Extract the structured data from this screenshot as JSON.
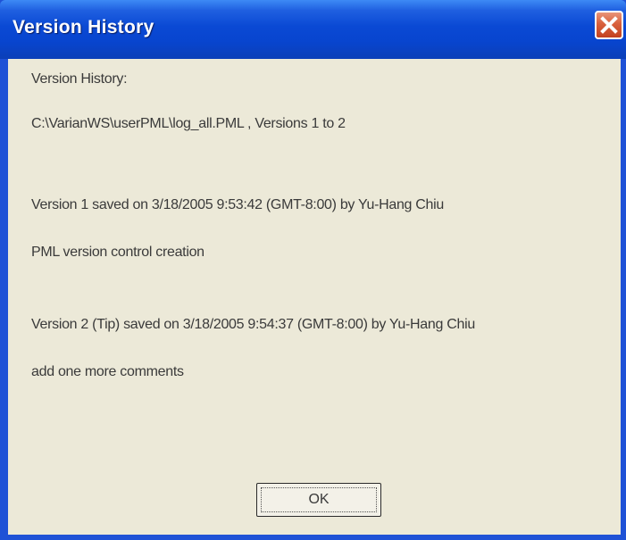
{
  "window": {
    "title": "Version History"
  },
  "content": {
    "heading": "Version History:",
    "file_line": "C:\\VarianWS\\userPML\\log_all.PML , Versions 1 to 2",
    "entries": [
      {
        "header": "Version 1 saved on 3/18/2005 9:53:42 (GMT-8:00) by Yu-Hang Chiu",
        "comment": "PML version control creation"
      },
      {
        "header": "Version 2 (Tip) saved on 3/18/2005 9:54:37 (GMT-8:00) by Yu-Hang Chiu",
        "comment": "add one more comments"
      }
    ]
  },
  "buttons": {
    "ok_label": "OK"
  },
  "colors": {
    "titlebar": "#0a49d4",
    "frame": "#1f52d6",
    "dialog_bg": "#ece9d8",
    "close_button": "#d9603c"
  },
  "icons": {
    "close": "close-icon"
  }
}
